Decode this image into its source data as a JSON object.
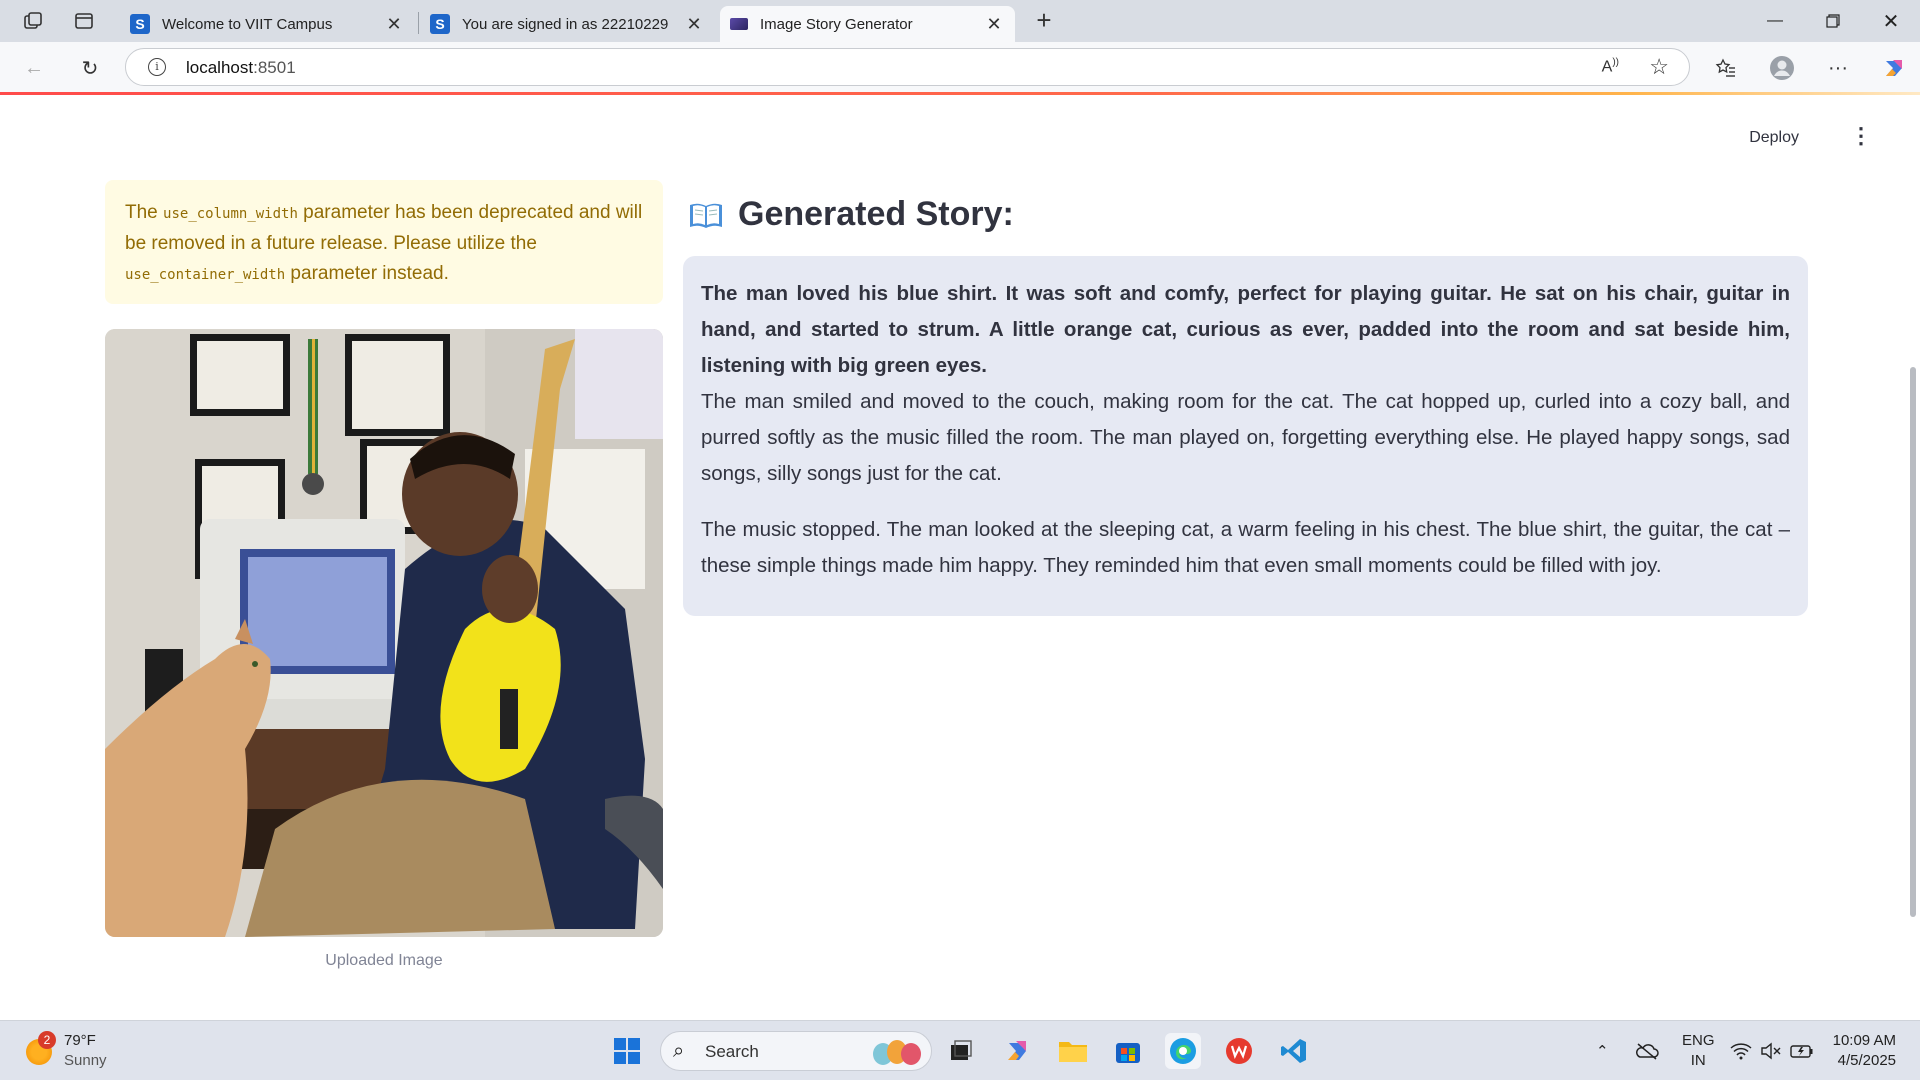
{
  "browser": {
    "tabs": [
      {
        "title": "Welcome to VIIT Campus",
        "favicon": "S",
        "active": false
      },
      {
        "title": "You are signed in as 22210229",
        "favicon": "S",
        "active": false
      },
      {
        "title": "Image Story Generator",
        "favicon": "",
        "active": true
      }
    ],
    "url_host": "localhost",
    "url_port": ":8501"
  },
  "app": {
    "deploy_label": "Deploy",
    "warning": {
      "text_1": "The ",
      "code_1": "use_column_width",
      "text_2": " parameter has been deprecated and will be removed in a future release. Please utilize the ",
      "code_2": "use_container_width",
      "text_3": " parameter instead."
    },
    "image_caption": "Uploaded Image",
    "story_heading": "Generated Story:",
    "story": {
      "paragraph_1": "The man loved his blue shirt. It was soft and comfy, perfect for playing guitar. He sat on his chair, guitar in hand, and started to strum. A little orange cat, curious as ever, padded into the room and sat beside him, listening with big green eyes.",
      "paragraph_2": "The man smiled and moved to the couch, making room for the cat. The cat hopped up, curled into a cozy ball, and purred softly as the music filled the room. The man played on, forgetting everything else. He played happy songs, sad songs, silly songs just for the cat.",
      "paragraph_3": "The music stopped. The man looked at the sleeping cat, a warm feeling in his chest. The blue shirt, the guitar, the cat – these simple things made him happy. They reminded him that even small moments could be filled with joy."
    }
  },
  "taskbar": {
    "weather_badge": "2",
    "temperature": "79°F",
    "condition": "Sunny",
    "search_placeholder": "Search",
    "lang_1": "ENG",
    "lang_2": "IN",
    "time": "10:09 AM",
    "date": "4/5/2025"
  },
  "colors": {
    "accent": "#ff4b4b",
    "warning_bg": "#fffbe3",
    "warning_text": "#926c05",
    "story_bg": "#e6e9f3",
    "text": "#31333f"
  }
}
